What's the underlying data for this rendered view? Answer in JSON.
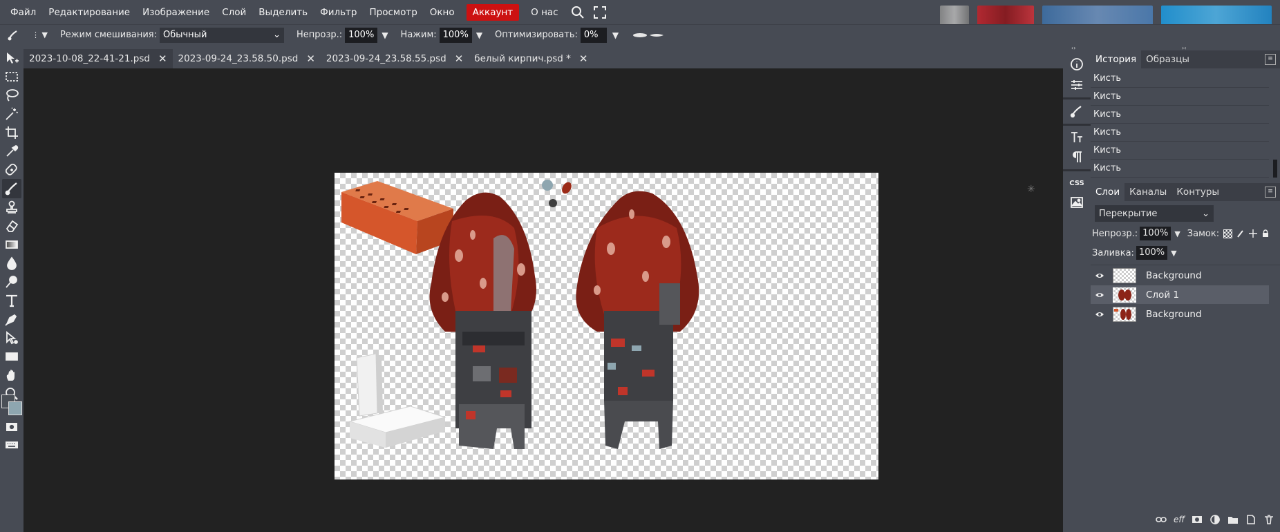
{
  "menu": {
    "items": [
      "Файл",
      "Редактирование",
      "Изображение",
      "Слой",
      "Выделить",
      "Фильтр",
      "Просмотр",
      "Окно"
    ],
    "account": "Аккаунт",
    "about": "О нас"
  },
  "options": {
    "blend_label": "Режим смешивания:",
    "blend_value": "Обычный",
    "opacity_label": "Непрозр.:",
    "opacity_value": "100%",
    "pressure_label": "Нажим:",
    "pressure_value": "100%",
    "optimize_label": "Оптимизировать:",
    "optimize_value": "0%"
  },
  "tabs": [
    {
      "label": "2023-10-08_22-41-21.psd",
      "active": true
    },
    {
      "label": "2023-09-24_23.58.50.psd",
      "active": false
    },
    {
      "label": "2023-09-24_23.58.55.psd",
      "active": false
    },
    {
      "label": "белый кирпич.psd *",
      "active": false
    }
  ],
  "history": {
    "tab_history": "История",
    "tab_swatches": "Образцы",
    "items": [
      "Кисть",
      "Кисть",
      "Кисть",
      "Кисть",
      "Кисть",
      "Кисть"
    ]
  },
  "layers": {
    "tab_layers": "Слои",
    "tab_channels": "Каналы",
    "tab_paths": "Контуры",
    "blend_mode": "Перекрытие",
    "opacity_label": "Непрозр.:",
    "opacity_value": "100%",
    "lock_label": "Замок:",
    "fill_label": "Заливка:",
    "fill_value": "100%",
    "items": [
      {
        "name": "Background",
        "selected": false
      },
      {
        "name": "Слой 1",
        "selected": true
      },
      {
        "name": "Background",
        "selected": false
      }
    ]
  },
  "side_strip": {
    "css_label": "CSS"
  },
  "colors": {
    "accent_red": "#cc1111",
    "chrome": "#474b54",
    "workspace": "#222222"
  }
}
